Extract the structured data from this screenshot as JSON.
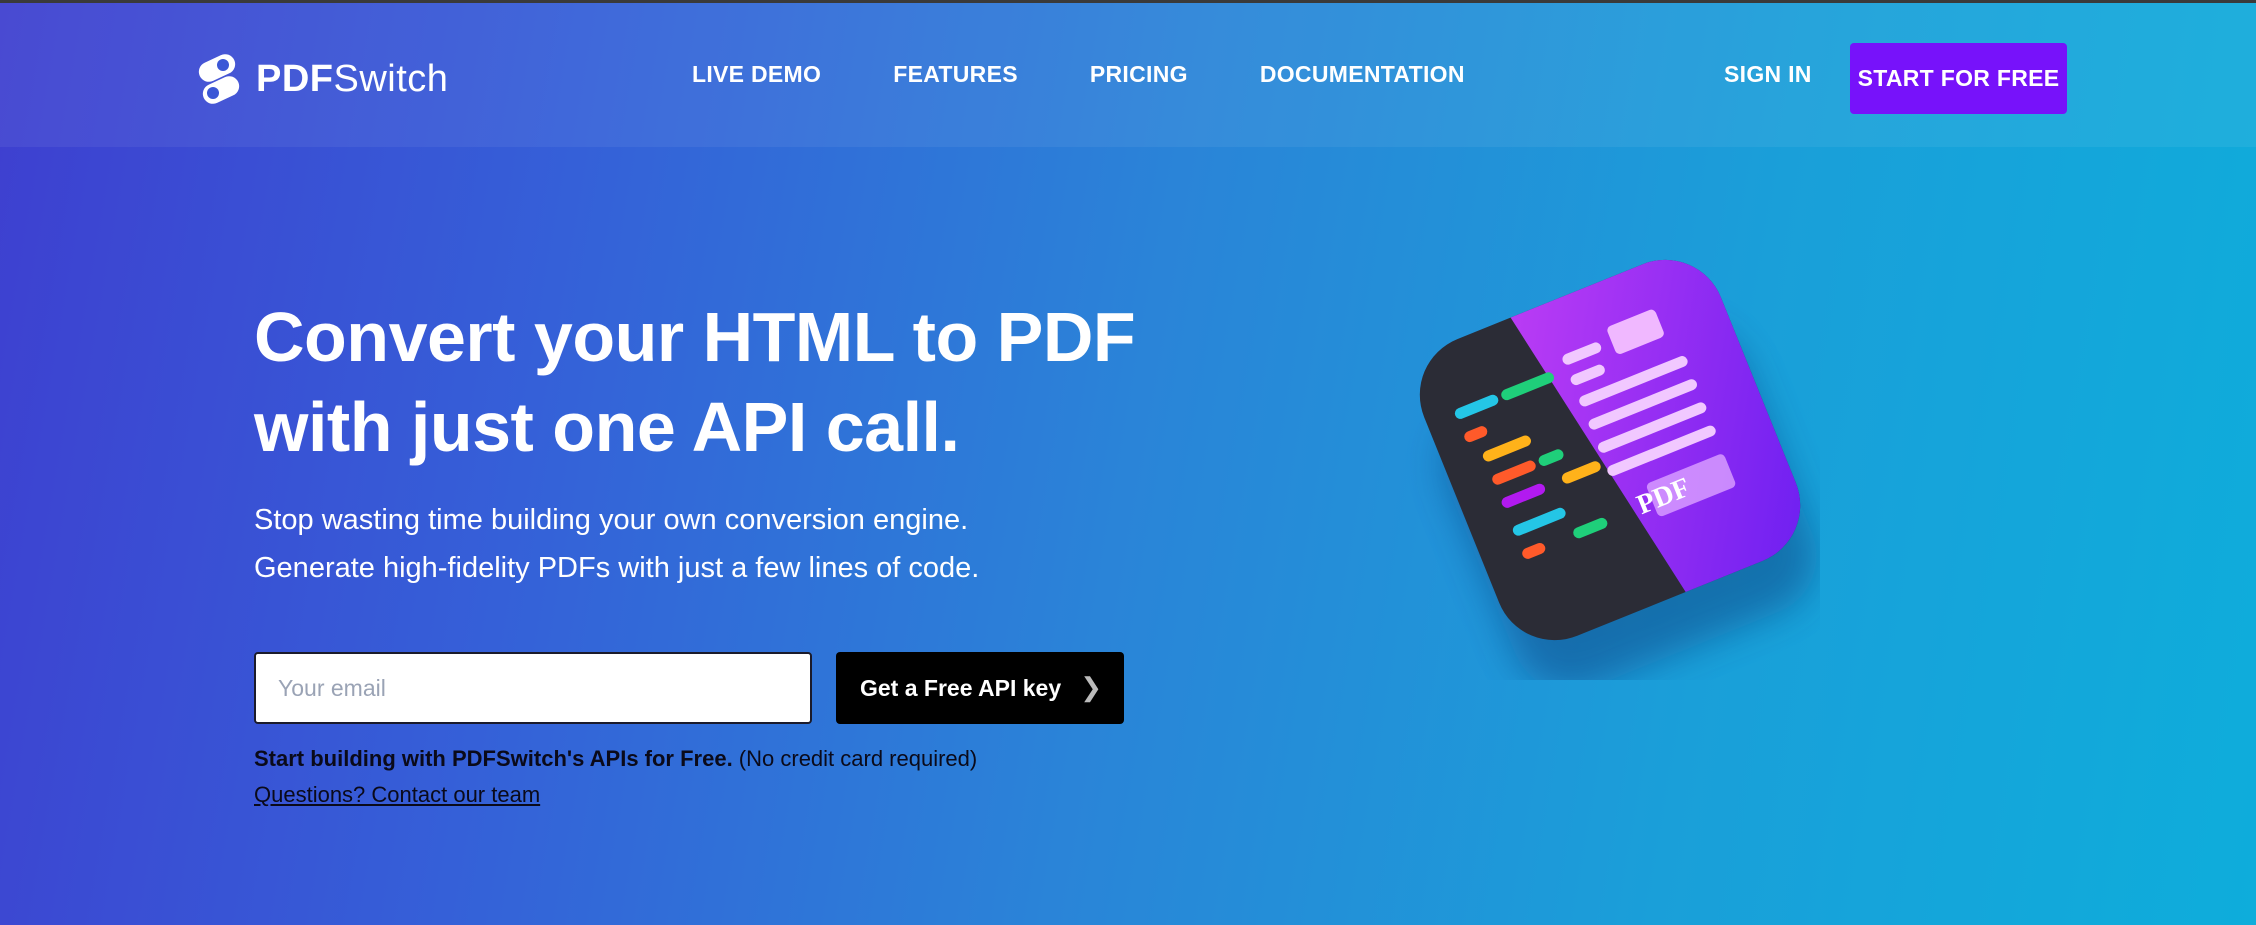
{
  "brand": {
    "name_bold": "PDF",
    "name_light": "Switch",
    "logo_icon": "switch-toggle-icon",
    "primary_color": "#7712fa"
  },
  "nav": {
    "items": [
      {
        "label": "LIVE DEMO"
      },
      {
        "label": "FEATURES"
      },
      {
        "label": "PRICING"
      },
      {
        "label": "DOCUMENTATION"
      }
    ],
    "sign_in": "SIGN IN",
    "start_free": "START FOR FREE"
  },
  "hero": {
    "title_line1": "Convert your HTML to PDF",
    "title_line2": "with just one API call.",
    "subtitle_line1": "Stop wasting time building your own conversion engine.",
    "subtitle_line2": "Generate high-fidelity PDFs with just a few lines of code.",
    "email_placeholder": "Your email",
    "email_value": "",
    "cta_label": "Get a Free API key",
    "cta_icon": "chevron-right-icon",
    "note_bold": "Start building with PDFSwitch's APIs for Free.",
    "note_rest": " (No credit card required)",
    "contact_link": "Questions? Contact our team"
  },
  "illustration": {
    "icon": "html-to-pdf-app-icon",
    "badge": "PDF"
  }
}
